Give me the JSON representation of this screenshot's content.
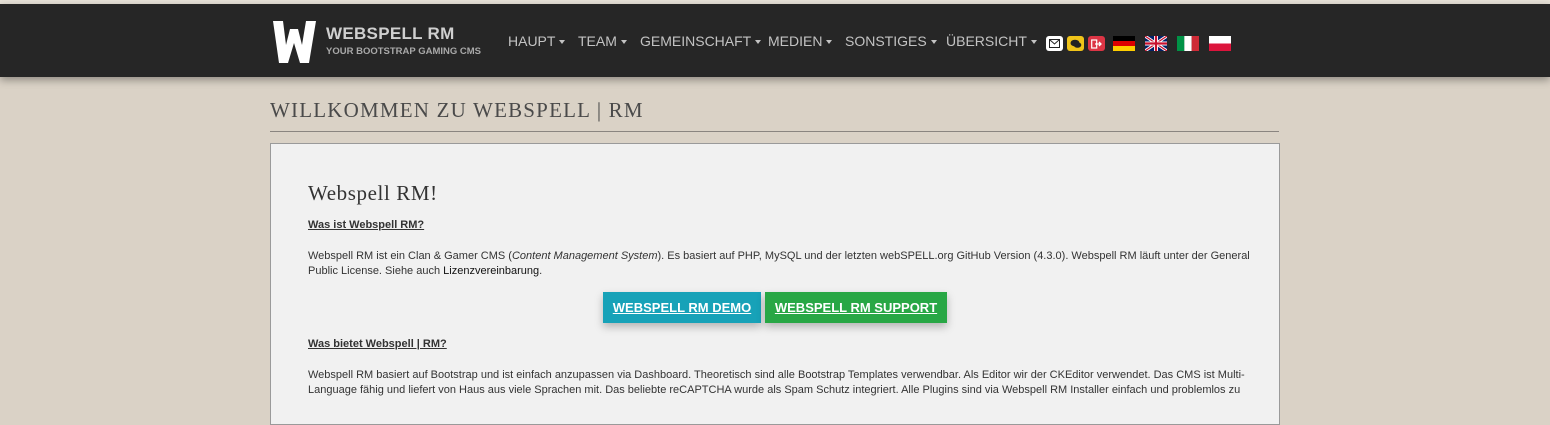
{
  "brand": {
    "name": "WEBSPELL RM",
    "tagline": "YOUR BOOTSTRAP GAMING CMS"
  },
  "nav": [
    {
      "label": "HAUPT"
    },
    {
      "label": "TEAM"
    },
    {
      "label": "GEMEINSCHAFT"
    },
    {
      "label": "MEDIEN"
    },
    {
      "label": "SONSTIGES"
    },
    {
      "label": "ÜBERSICHT"
    }
  ],
  "header_icons": [
    "mail-icon",
    "chat-icon",
    "logout-icon"
  ],
  "flags": [
    "flag-de",
    "flag-uk",
    "flag-it",
    "flag-pl"
  ],
  "page": {
    "title": "WILLKOMMEN ZU WEBSPELL | RM"
  },
  "card": {
    "title": "Webspell RM!",
    "q1": "Was ist Webspell RM?",
    "p1_a": "Webspell RM ist ein Clan & Gamer CMS (",
    "p1_em": "Content Management System",
    "p1_b": "). Es basiert auf PHP, MySQL und der letzten webSPELL.org GitHub Version (4.3.0). Webspell RM läuft unter der General Public License. Siehe auch ",
    "p1_link": "Lizenzvereinbarung",
    "p1_end": ".",
    "btn_demo": "WEBSPELL RM DEMO",
    "btn_support": "WEBSPELL RM SUPPORT",
    "q2": "Was bietet Webspell | RM?",
    "p2": "Webspell RM basiert auf Bootstrap und ist einfach anzupassen via Dashboard. Theoretisch sind alle Bootstrap Templates verwendbar. Als Editor wir der CKEditor verwendet. Das CMS ist Multi-Language fähig und liefert von Haus aus viele Sprachen mit. Das beliebte reCAPTCHA wurde als Spam Schutz integriert. Alle Plugins sind via Webspell RM Installer einfach und problemlos zu"
  },
  "colors": {
    "navbar": "#262626",
    "background": "#dad2c6",
    "demo": "#17a2b8",
    "support": "#28a745"
  }
}
